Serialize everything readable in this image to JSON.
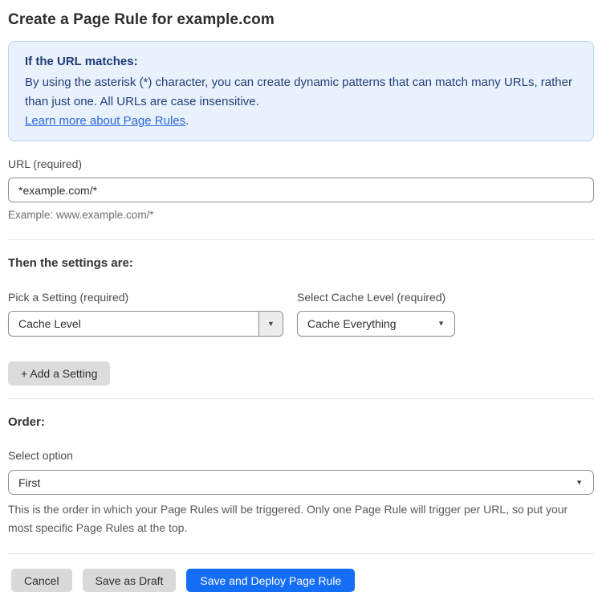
{
  "page_title": "Create a Page Rule for example.com",
  "info_box": {
    "heading": "If the URL matches:",
    "body": "By using the asterisk (*) character, you can create dynamic patterns that can match many URLs, rather than just one. All URLs are case insensitive.",
    "link_label": "Learn more about Page Rules",
    "link_suffix": "."
  },
  "url_field": {
    "label": "URL (required)",
    "value": "*example.com/*",
    "helper": "Example: www.example.com/*"
  },
  "settings_section": {
    "heading": "Then the settings are:",
    "setting_picker": {
      "label": "Pick a Setting (required)",
      "value": "Cache Level"
    },
    "cache_level_picker": {
      "label": "Select Cache Level (required)",
      "value": "Cache Everything"
    },
    "add_setting_label": "+ Add a Setting"
  },
  "order_section": {
    "heading": "Order:",
    "select_label": "Select option",
    "value": "First",
    "helper": "This is the order in which your Page Rules will be triggered. Only one Page Rule will trigger per URL, so put your most specific Page Rules at the top."
  },
  "footer": {
    "cancel_label": "Cancel",
    "save_draft_label": "Save as Draft",
    "save_deploy_label": "Save and Deploy Page Rule"
  },
  "icons": {
    "dropdown_arrow": "▼"
  },
  "colors": {
    "primary_button_blue": "#146ef5",
    "info_box_background": "#e8f1fc",
    "info_box_border": "#b9d3f1",
    "info_box_text": "#1e3c78",
    "link_blue": "#2d68d8",
    "gray_button": "#d9d9d9",
    "input_border": "#8f8f8f",
    "divider": "#e2e2e2"
  }
}
